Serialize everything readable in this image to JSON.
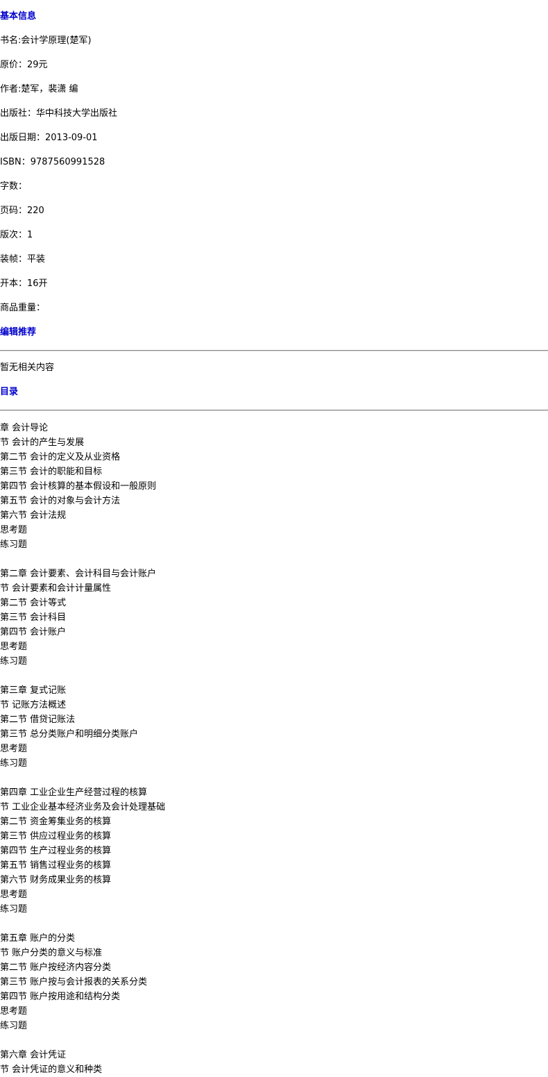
{
  "basic_info": {
    "heading": "基本信息",
    "lines": [
      "书名:会计学原理(楚军)",
      "原价：29元",
      "作者:楚军，裴潇 编",
      "出版社：华中科技大学出版社",
      "出版日期：2013-09-01",
      "ISBN：9787560991528",
      "字数：",
      "页码：220",
      "版次：1",
      "装帧：平装",
      "开本：16开",
      "商品重量："
    ]
  },
  "editor_recommend": {
    "heading": "编辑推荐",
    "text": "暂无相关内容"
  },
  "toc": {
    "heading": "目录",
    "chapters": [
      [
        "章 会计导论",
        "节 会计的产生与发展",
        "第二节 会计的定义及从业资格",
        "第三节 会计的职能和目标",
        "第四节 会计核算的基本假设和一般原则",
        "第五节 会计的对象与会计方法",
        "第六节 会计法规",
        "思考题",
        "练习题"
      ],
      [
        "第二章 会计要素、会计科目与会计账户",
        "节 会计要素和会计计量属性",
        "第二节 会计等式",
        "第三节 会计科目",
        "第四节 会计账户",
        "思考题",
        "练习题"
      ],
      [
        "第三章 复式记账",
        "节 记账方法概述",
        "第二节 借贷记账法",
        "第三节 总分类账户和明细分类账户",
        "思考题",
        "练习题"
      ],
      [
        "第四章 工业企业生产经营过程的核算",
        "节 工业企业基本经济业务及会计处理基础",
        "第二节 资金筹集业务的核算",
        "第三节 供应过程业务的核算",
        "第四节 生产过程业务的核算",
        "第五节 销售过程业务的核算",
        "第六节 财务成果业务的核算",
        "思考题",
        "练习题"
      ],
      [
        "第五章 账户的分类",
        "节 账户分类的意义与标准",
        "第二节 账户按经济内容分类",
        "第三节 账户按与会计报表的关系分类",
        "第四节 账户按用途和结构分类",
        "思考题",
        "练习题"
      ],
      [
        "第六章 会计凭证",
        "节 会计凭证的意义和种类"
      ]
    ]
  }
}
